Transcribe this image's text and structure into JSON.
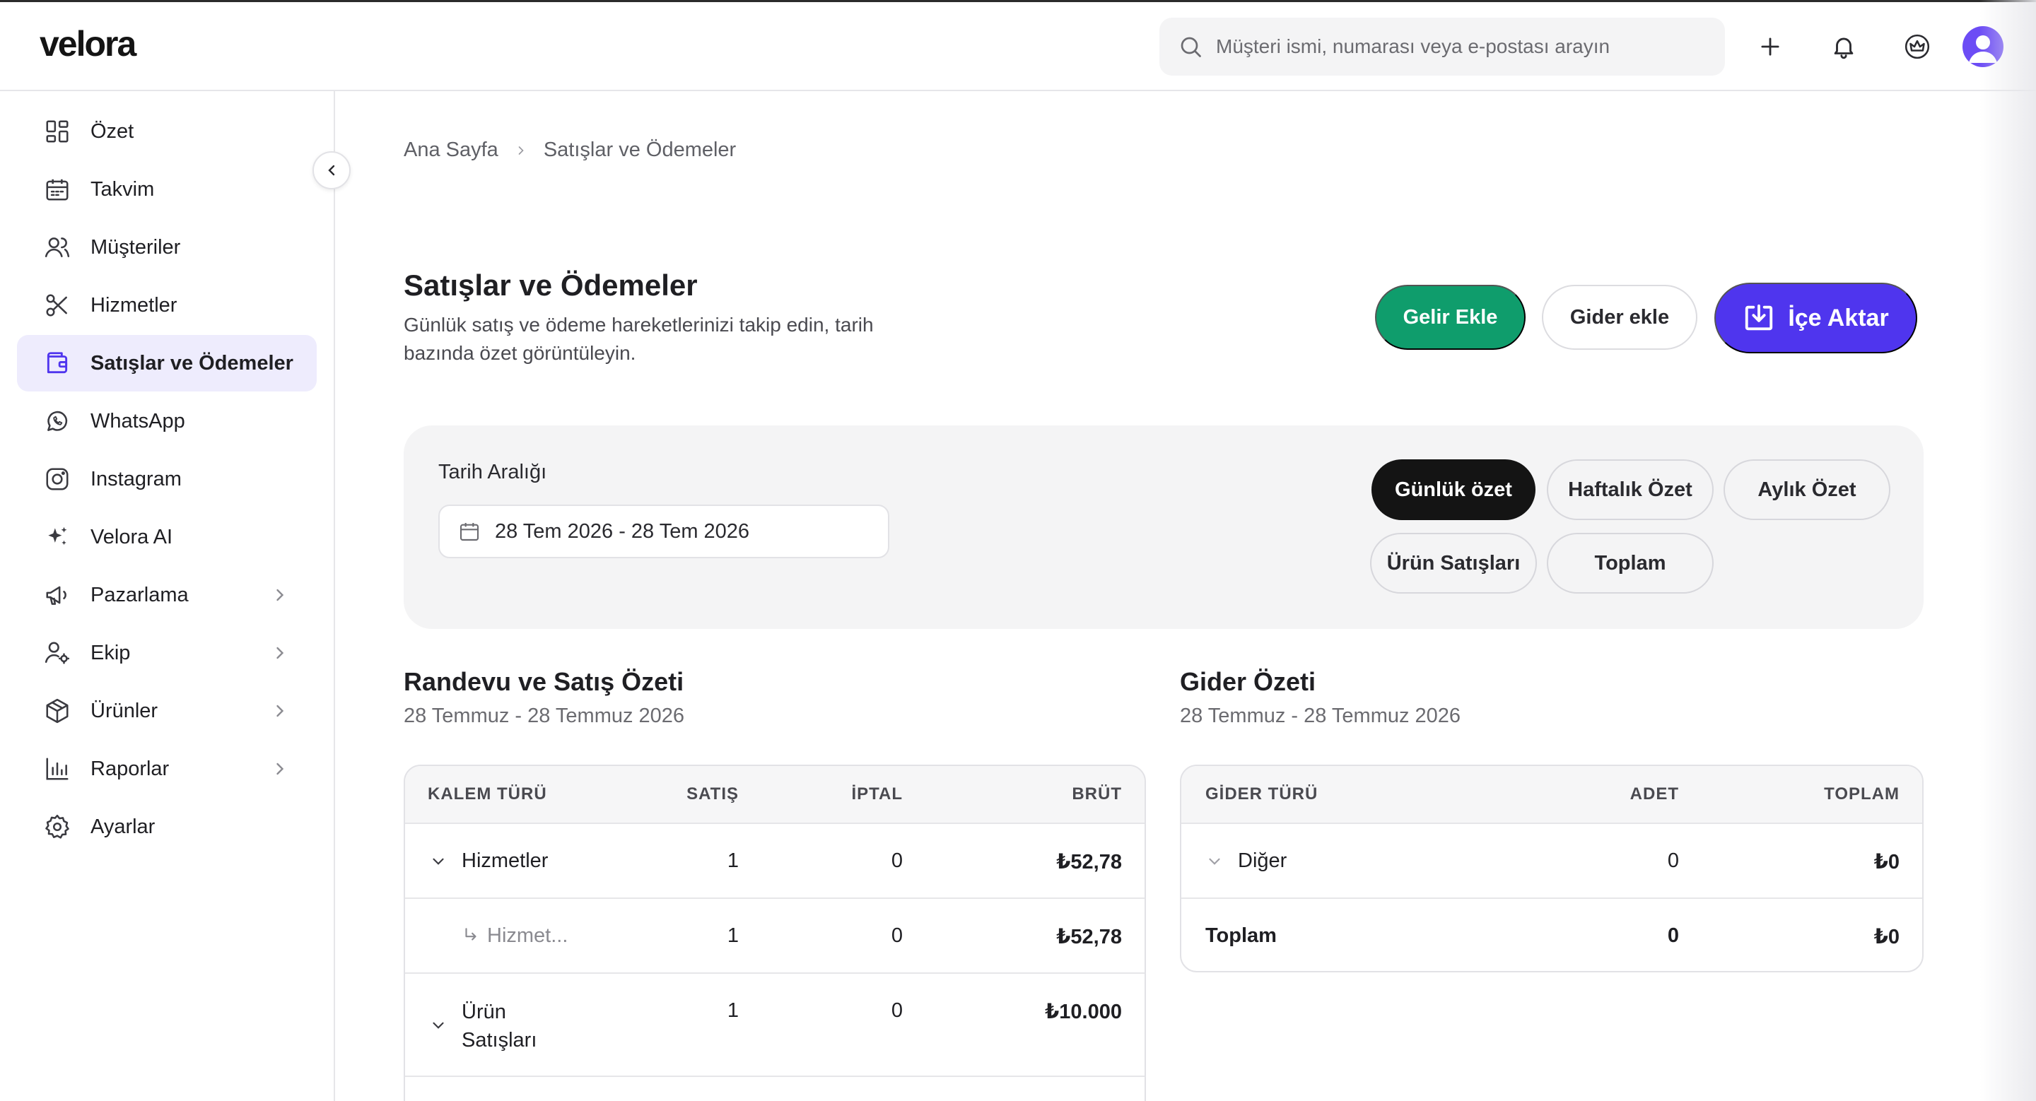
{
  "app": {
    "logo": "velora"
  },
  "header": {
    "search_placeholder": "Müşteri ismi, numarası veya e-postası arayın",
    "icons": [
      "search-icon",
      "plus-icon",
      "bell-icon",
      "crown-icon",
      "avatar"
    ]
  },
  "colors": {
    "primary": "#4f35ee",
    "success": "#0f9d6c",
    "active_nav_bg": "#eeecfd",
    "dark_pill": "#141414",
    "avatar": "#6c4cf5"
  },
  "sidebar": {
    "items": [
      {
        "label": "Özet",
        "icon": "grid-icon"
      },
      {
        "label": "Takvim",
        "icon": "calendar-icon"
      },
      {
        "label": "Müşteriler",
        "icon": "users-icon"
      },
      {
        "label": "Hizmetler",
        "icon": "scissors-icon"
      },
      {
        "label": "Satışlar ve Ödemeler",
        "icon": "wallet-icon",
        "active": true
      },
      {
        "label": "WhatsApp",
        "icon": "whatsapp-icon"
      },
      {
        "label": "Instagram",
        "icon": "instagram-icon"
      },
      {
        "label": "Velora AI",
        "icon": "sparkle-icon"
      },
      {
        "label": "Pazarlama",
        "icon": "megaphone-icon",
        "has_children": true
      },
      {
        "label": "Ekip",
        "icon": "team-icon",
        "has_children": true
      },
      {
        "label": "Ürünler",
        "icon": "box-icon",
        "has_children": true
      },
      {
        "label": "Raporlar",
        "icon": "chart-icon",
        "has_children": true
      },
      {
        "label": "Ayarlar",
        "icon": "gear-icon"
      }
    ]
  },
  "breadcrumb": {
    "home": "Ana Sayfa",
    "current": "Satışlar ve Ödemeler"
  },
  "page": {
    "title": "Satışlar ve Ödemeler",
    "description": "Günlük satış ve ödeme hareketlerinizi takip edin, tarih bazında özet görüntüleyin."
  },
  "actions": {
    "income": "Gelir Ekle",
    "expense": "Gider ekle",
    "import": "İçe Aktar"
  },
  "filter": {
    "label": "Tarih Aralığı",
    "date_range": "28 Tem 2026 - 28 Tem 2026",
    "pills": [
      {
        "label": "Günlük özet",
        "active": true
      },
      {
        "label": "Haftalık Özet"
      },
      {
        "label": "Aylık Özet"
      },
      {
        "label": "Ürün Satışları"
      },
      {
        "label": "Toplam"
      }
    ]
  },
  "sales_summary": {
    "title": "Randevu ve Satış Özeti",
    "subtitle": "28 Temmuz - 28 Temmuz 2026",
    "columns": [
      "KALEM TÜRÜ",
      "SATIŞ",
      "İPTAL",
      "BRÜT"
    ],
    "rows": [
      {
        "type": "Hizmetler",
        "sales": "1",
        "cancel": "0",
        "gross": "₺52,78"
      },
      {
        "type": "Hizmet...",
        "sales": "1",
        "cancel": "0",
        "gross": "₺52,78",
        "child": true
      },
      {
        "type": "Ürün Satışları",
        "sales": "1",
        "cancel": "0",
        "gross": "₺10.000"
      }
    ]
  },
  "expense_summary": {
    "title": "Gider Özeti",
    "subtitle": "28 Temmuz - 28 Temmuz 2026",
    "columns": [
      "GİDER TÜRÜ",
      "ADET",
      "TOPLAM"
    ],
    "rows": [
      {
        "type": "Diğer",
        "count": "0",
        "total": "₺0"
      }
    ],
    "total_row": {
      "label": "Toplam",
      "count": "0",
      "total": "₺0"
    }
  }
}
